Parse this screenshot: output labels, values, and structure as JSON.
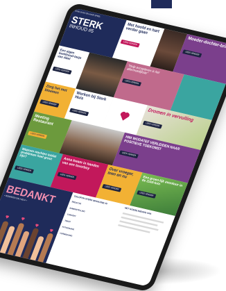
{
  "magazine": {
    "logo_line": "STAD SONG EN HAAR SPEEL",
    "cover_title": "STERK",
    "cover_subtitle": "INHOUD #5"
  },
  "tiles": {
    "mee_ergens": "Met hoofd en hart verder gaan",
    "mee_ergens_btn": "LEES VERDER",
    "moederdochter": "Moeder-dochter-brief",
    "moederdochter_btn": "LEES VERDER",
    "eigen_boekhouden": "Een eigen boekhoud-tasje van Abel",
    "eigen_boekhouden_btn": "LEES VERDER",
    "quote": "\"Hulp accepteren is het allermoeilijkste\"",
    "quote_btn": "LEES VERDER",
    "zorg": "Zorg het met bloemen",
    "zorg_btn": "LEES VERDER",
    "werken": "Werken bij Sterk Huis",
    "werken_btn": "LEES VERDER",
    "dromen": "Dromen in vervulling",
    "dromen_btn": "LEES VERDER",
    "meeting": "Meeting Restaurant",
    "meeting_btn": "LEES VERDER",
    "waarom": "Waarom wachten totdat problemen heel groot zijn?",
    "waarom_btn": "LEES VERDER",
    "anna": "Anna kwam in handen van een loverboy",
    "anna_btn": "LEES VERDER",
    "wodatef": "HIM WODATEF VERLEIDEN NAAR POSITIEVE TOEKOMST",
    "wodatef_btn": "LEES VERDER",
    "over": "Over vroeger, toen en nu",
    "over_btn": "LEES VERDER",
    "tuin": "Een groen-lijk avontuur in de Zuid-tuin",
    "tuin_btn": "LEES VERDER",
    "bedankt": "BEDANKT",
    "bedankt_sub": "• IEDEREEN DIE HIELP •"
  },
  "colophon": {
    "col1_heading": "COLOFON STERK MAGAZINE #5",
    "col1_lines": [
      "REDACTIE",
      "SAMENSTELLING",
      "CONCEPT",
      "TEKST",
      "FOTOGRAFIE",
      "VORMGEVING"
    ],
    "col2_heading": "HET GOEDE NIEUWS VAN"
  },
  "colors": {
    "navy": "#1f2b5a",
    "pink": "#c2185b",
    "teal": "#3aa5a0",
    "yellow": "#f2b134",
    "green": "#6c9a3d",
    "purple": "#7b3f8c",
    "orange": "#e8743b",
    "lilac": "#c08cc7"
  }
}
